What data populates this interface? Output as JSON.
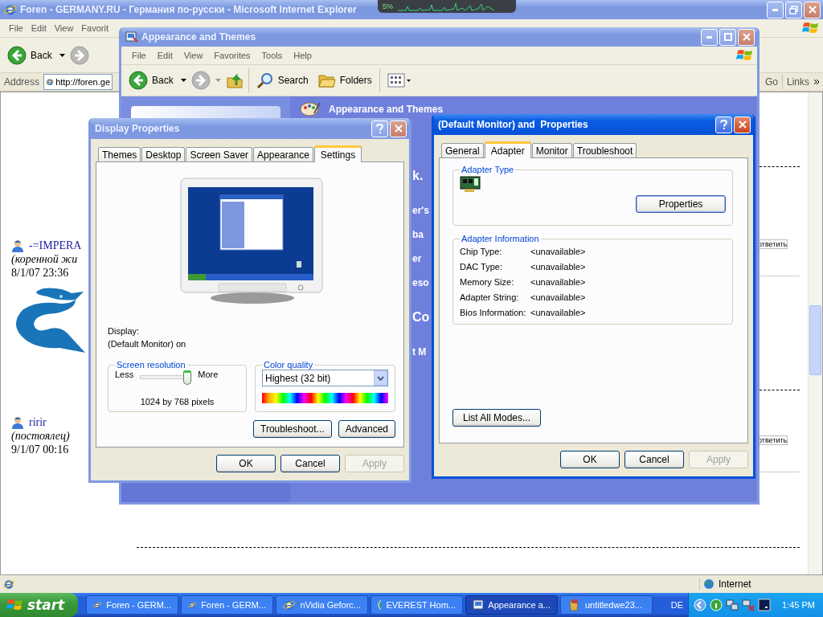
{
  "ie": {
    "title": "Foren - GERMANY.RU - Германия по-русски - Microsoft Internet Explorer",
    "menu": [
      "File",
      "Edit",
      "View",
      "Favorit"
    ],
    "back": "Back",
    "address_label": "Address",
    "address": "http://foren.ge",
    "go": "Go",
    "links": "Links",
    "posts": [
      {
        "author": "-=IMPERA",
        "rank": "(коренной жи",
        "time": "8/1/07 23:36",
        "avatar": true
      },
      {
        "author": "ririr",
        "rank": "(постоялец)",
        "time": "9/1/07 00:16",
        "avatar": false
      }
    ],
    "reply_links": [
      "ответить",
      "ответить"
    ],
    "zone": "Internet"
  },
  "cpu_meter": {
    "reading": "5%"
  },
  "explorer": {
    "title": "Appearance and Themes",
    "menu": [
      "File",
      "Edit",
      "View",
      "Favorites",
      "Tools",
      "Help"
    ],
    "back": "Back",
    "search": "Search",
    "folders": "Folders",
    "heading": "Appearance and Themes",
    "fragments": [
      {
        "text": "k.",
        "kind": "large"
      },
      {
        "text": "er's",
        "kind": "small"
      },
      {
        "text": "ba",
        "kind": "small"
      },
      {
        "text": "er",
        "kind": "small"
      },
      {
        "text": "eso",
        "kind": "small"
      },
      {
        "text": "Co",
        "kind": "large"
      },
      {
        "text": "t M",
        "kind": "small"
      }
    ]
  },
  "display_properties": {
    "title": "Display Properties",
    "tabs": [
      {
        "label": "Themes",
        "selected": false
      },
      {
        "label": "Desktop",
        "selected": false
      },
      {
        "label": "Screen Saver",
        "selected": false
      },
      {
        "label": "Appearance",
        "selected": false
      },
      {
        "label": "Settings",
        "selected": true
      }
    ],
    "display_label": "Display:",
    "display_value": "(Default Monitor) on",
    "resolution": {
      "legend": "Screen resolution",
      "less": "Less",
      "more": "More",
      "level": 1,
      "reading": "1024 by 768 pixels"
    },
    "color_quality": {
      "legend": "Color quality",
      "value": "Highest (32 bit)"
    },
    "panel_buttons": [
      {
        "label": "Troubleshoot...",
        "disabled": false
      },
      {
        "label": "Advanced",
        "disabled": false
      }
    ],
    "buttons": [
      {
        "label": "OK",
        "disabled": false
      },
      {
        "label": "Cancel",
        "disabled": false
      },
      {
        "label": "Apply",
        "disabled": true
      }
    ]
  },
  "monitor_properties": {
    "title": "(Default Monitor) and  Properties",
    "tabs": [
      {
        "label": "General",
        "selected": false
      },
      {
        "label": "Adapter",
        "selected": true
      },
      {
        "label": "Monitor",
        "selected": false
      },
      {
        "label": "Troubleshoot",
        "selected": false
      }
    ],
    "adapter_type": {
      "legend": "Adapter Type",
      "button": "Properties"
    },
    "adapter_info": {
      "legend": "Adapter Information",
      "rows": [
        {
          "label": "Chip Type:",
          "value": "<unavailable>"
        },
        {
          "label": "DAC Type:",
          "value": "<unavailable>"
        },
        {
          "label": "Memory Size:",
          "value": "<unavailable>"
        },
        {
          "label": "Adapter String:",
          "value": "<unavailable>"
        },
        {
          "label": "Bios Information:",
          "value": "<unavailable>"
        }
      ]
    },
    "list_button": "List All Modes...",
    "buttons": [
      {
        "label": "OK",
        "disabled": false
      },
      {
        "label": "Cancel",
        "disabled": false
      },
      {
        "label": "Apply",
        "disabled": true
      }
    ]
  },
  "taskbar": {
    "start": "start",
    "items": [
      {
        "label": "Foren - GERM...",
        "kind": "browser",
        "selected": false
      },
      {
        "label": "Foren - GERM...",
        "kind": "browser",
        "selected": false
      },
      {
        "label": "nVidia Geforc...",
        "kind": "browser",
        "selected": false
      },
      {
        "label": "EVEREST Hom...",
        "kind": "info",
        "selected": false
      },
      {
        "label": "Appearance a...",
        "kind": "control",
        "selected": true
      },
      {
        "label": "untitledwe23...",
        "kind": "paint",
        "selected": false
      }
    ],
    "language": "DE",
    "clock": "1:45 PM"
  }
}
